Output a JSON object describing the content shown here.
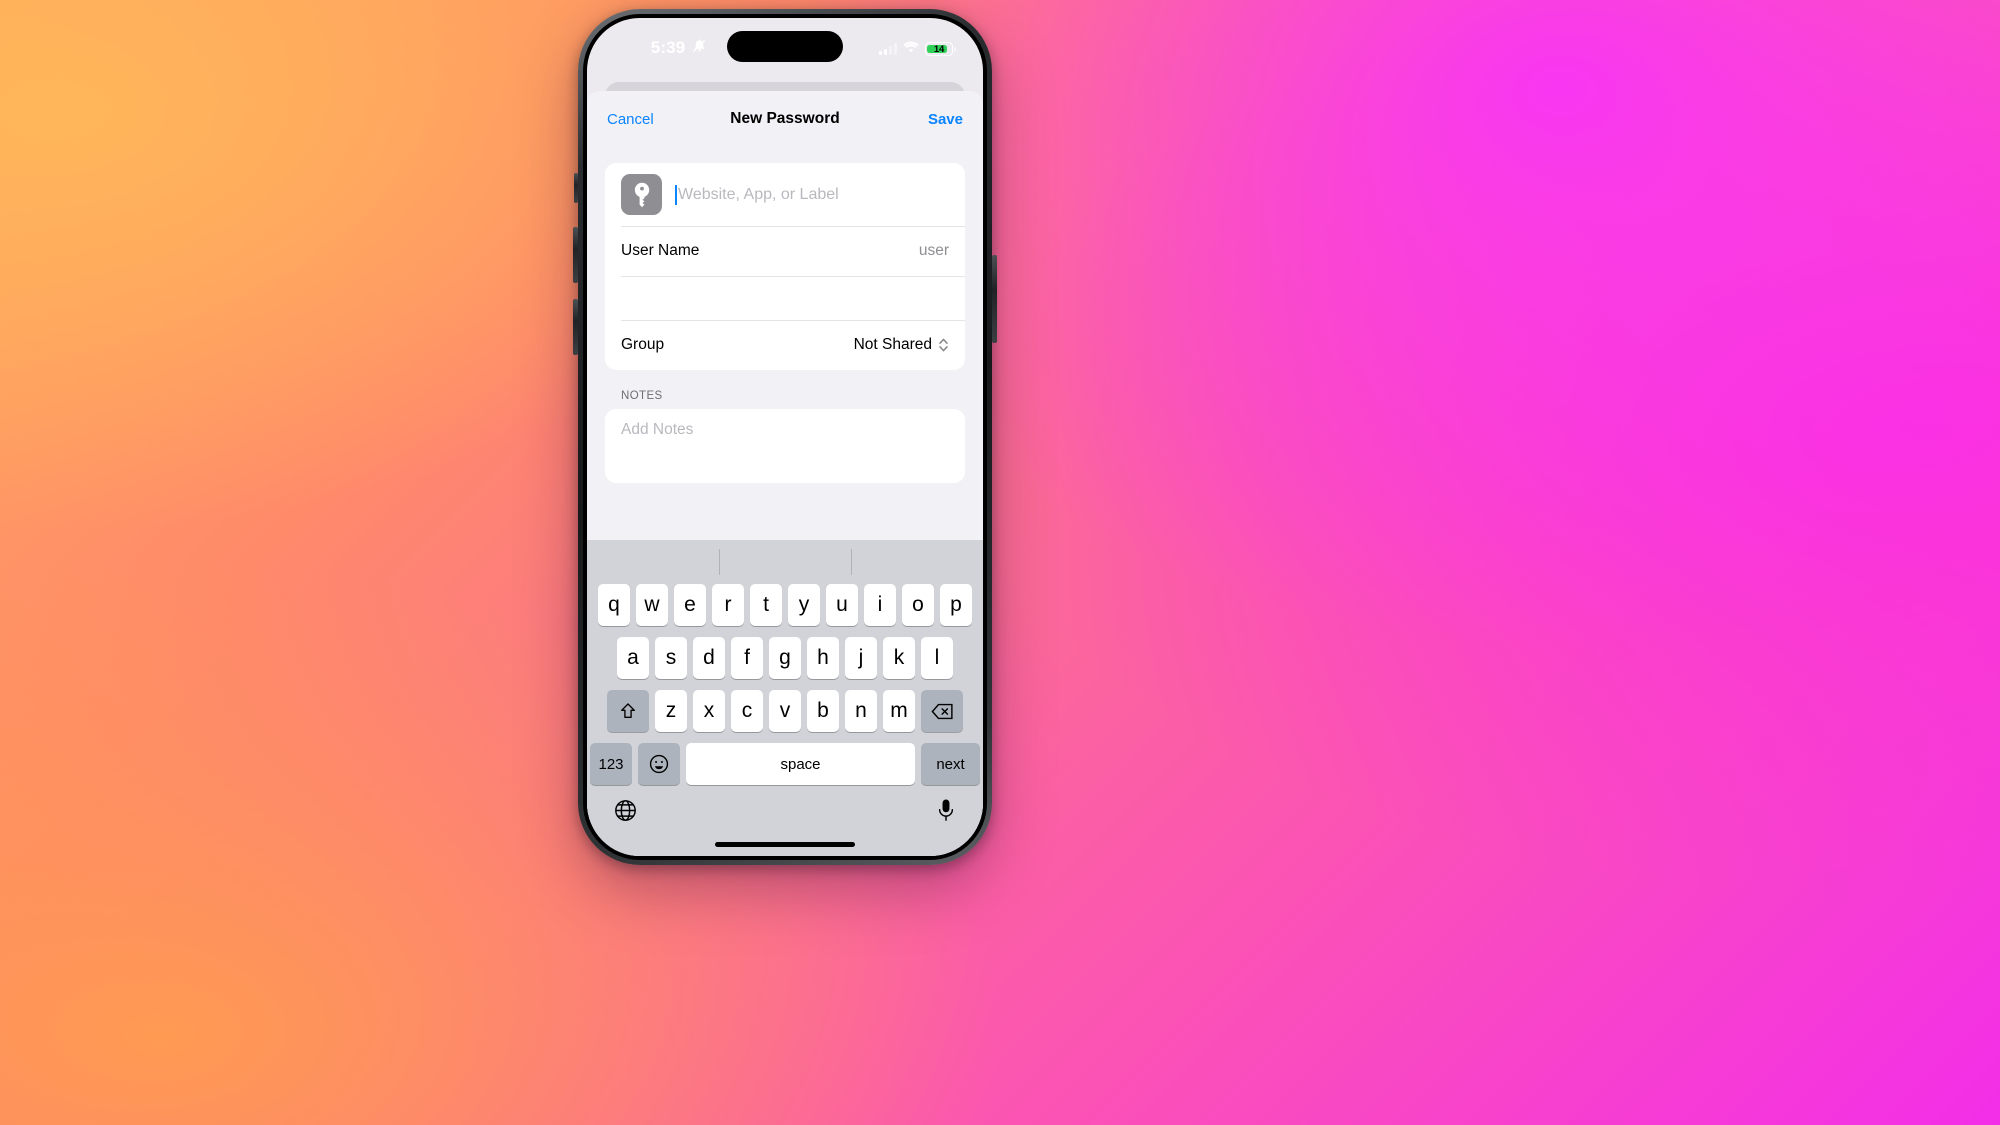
{
  "status_bar": {
    "time": "5:39",
    "silent_icon": "bell-slash-icon",
    "cellular_icon": "signal-bars-icon",
    "wifi_icon": "wifi-icon",
    "battery_level": "14"
  },
  "nav": {
    "cancel_label": "Cancel",
    "title": "New Password",
    "save_label": "Save"
  },
  "form": {
    "title_field": {
      "icon": "key-icon",
      "placeholder": "Website, App, or Label",
      "value": ""
    },
    "username_row": {
      "label": "User Name",
      "value": "user"
    },
    "password_row": {
      "label": "",
      "value": ""
    },
    "group_row": {
      "label": "Group",
      "value": "Not Shared",
      "stepper_icon": "chevron-up-down-icon"
    }
  },
  "notes": {
    "header": "NOTES",
    "placeholder": "Add Notes"
  },
  "keyboard": {
    "row1": [
      "q",
      "w",
      "e",
      "r",
      "t",
      "y",
      "u",
      "i",
      "o",
      "p"
    ],
    "row2": [
      "a",
      "s",
      "d",
      "f",
      "g",
      "h",
      "j",
      "k",
      "l"
    ],
    "row3": [
      "z",
      "x",
      "c",
      "v",
      "b",
      "n",
      "m"
    ],
    "shift_icon": "shift-arrow-icon",
    "backspace_icon": "backspace-icon",
    "numbers_label": "123",
    "emoji_icon": "smiley-face-icon",
    "space_label": "space",
    "return_label": "next",
    "globe_icon": "globe-icon",
    "mic_icon": "microphone-icon"
  },
  "colors": {
    "accent": "#0a84ff",
    "battery_green": "#30d158",
    "key_icon_bg": "#8e8e93",
    "keyboard_bg": "#d1d3d9"
  }
}
